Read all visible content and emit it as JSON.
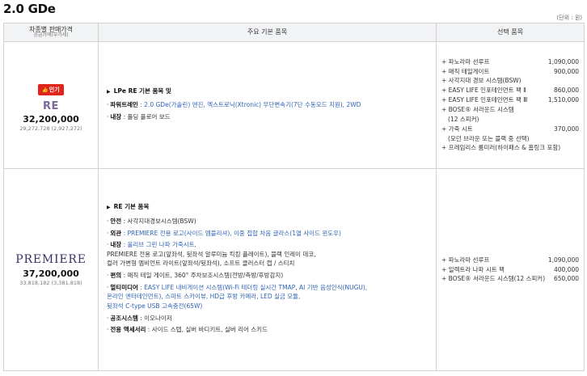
{
  "page": {
    "title": "2.0 GDe",
    "unit": "(단위 : 원)"
  },
  "header": {
    "col1": "차종별 판매가격",
    "col1_sub": "공급가액(부가세)",
    "col2": "주요 기본 품목",
    "col3": "선택 품목"
  },
  "rows": [
    {
      "badge": "인기",
      "trim": "RE",
      "price": "32,200,000",
      "price_sub": "29,272,728 (2,927,272)",
      "features_head": "LPe RE 기본 품목 및",
      "features": [
        {
          "label": "파워트레인",
          "text": " : 2.0 GDe(가솔린) 엔진, 엑스트로닉(Xtronic) 무단변속기(7단 수동모드 지원), 2WD"
        },
        {
          "label": "내장",
          "text": " : 폴딩 플로어 보드"
        }
      ],
      "options": [
        {
          "name": "+ 파노라마 선루프",
          "price": "1,090,000"
        },
        {
          "name": "+ 매직 테일게이트",
          "price": "900,000"
        },
        {
          "name": "+ 사각지대 경보 시스템(BSW)",
          "price": ""
        },
        {
          "name": "+ EASY LIFE 인포테인먼트 팩 Ⅱ",
          "price": "860,000"
        },
        {
          "name": "+ EASY LIFE 인포테인먼트 팩 Ⅲ",
          "price": "1,510,000"
        },
        {
          "name": "+ BOSE® 서라운드 시스템",
          "price": ""
        },
        {
          "name": "(12 스피커)",
          "price": "",
          "note": true
        },
        {
          "name": "+ 가죽 시트",
          "price": "370,000"
        },
        {
          "name": "(모던 브라운 또는 블랙 중 선택)",
          "price": "",
          "note": true
        },
        {
          "name": "+ 프레임리스 룸미러(하이패스 & 홈링크 포함)",
          "price": ""
        }
      ]
    },
    {
      "trim": "PREMIERE",
      "price": "37,200,000",
      "price_sub": "33,818,182 (3,381,818)",
      "features_head": "RE 기본 품목",
      "features": [
        {
          "label": "안전",
          "text": " : 사각지대경보시스템(BSW)"
        },
        {
          "label": "외관",
          "text": " : PREMIERE 전용 로고(사이드 엠블리셔), 이중 접합 차음 글라스(1열 사이드 윈도우)"
        },
        {
          "label": "내장",
          "text": " : 올리브 그린 나파 가죽시트,",
          "more": [
            "PREMIERE 전용 로고(앞좌석, 뒷좌석 알루미늄 킥킹 플레이트), 블랙 인레이 데코,",
            "컬러 가변형 엠비언트 라이트(앞좌석/뒷좌석), 소프트 클러스터 캡 / 스티치"
          ]
        },
        {
          "label": "편의",
          "text": " : 매직 테일 게이트, 360° 주차보조시스템(전방/측방/후방감지)"
        },
        {
          "label": "멀티미디어",
          "text": " : EASY LIFE 내비게이션 시스템(Wi-Fi 테더링 실시간 TMAP, AI 기반 음성인식(NUGU),",
          "more": [
            "온라인 엔터테인먼트), 스마트 스카이뷰, HD급 후방 카메라, LED 실금 모듈,",
            "뒷좌석 C-type USB 고속충전(65W)"
          ]
        },
        {
          "label": "공조시스템",
          "text": " : 이오나이저"
        },
        {
          "label": "전용 액세서리",
          "text": " : 사이드 스텝, 실버 바디키트, 실버 리어 스키드"
        }
      ],
      "options": [
        {
          "name": "+ 파노라마 선루프",
          "price": "1,090,000"
        },
        {
          "name": "+ 일렉트라 나파 시트 팩",
          "price": "400,000"
        },
        {
          "name": "+ BOSE® 서라운드 시스템(12 스피커)",
          "price": "650,000"
        }
      ]
    }
  ]
}
